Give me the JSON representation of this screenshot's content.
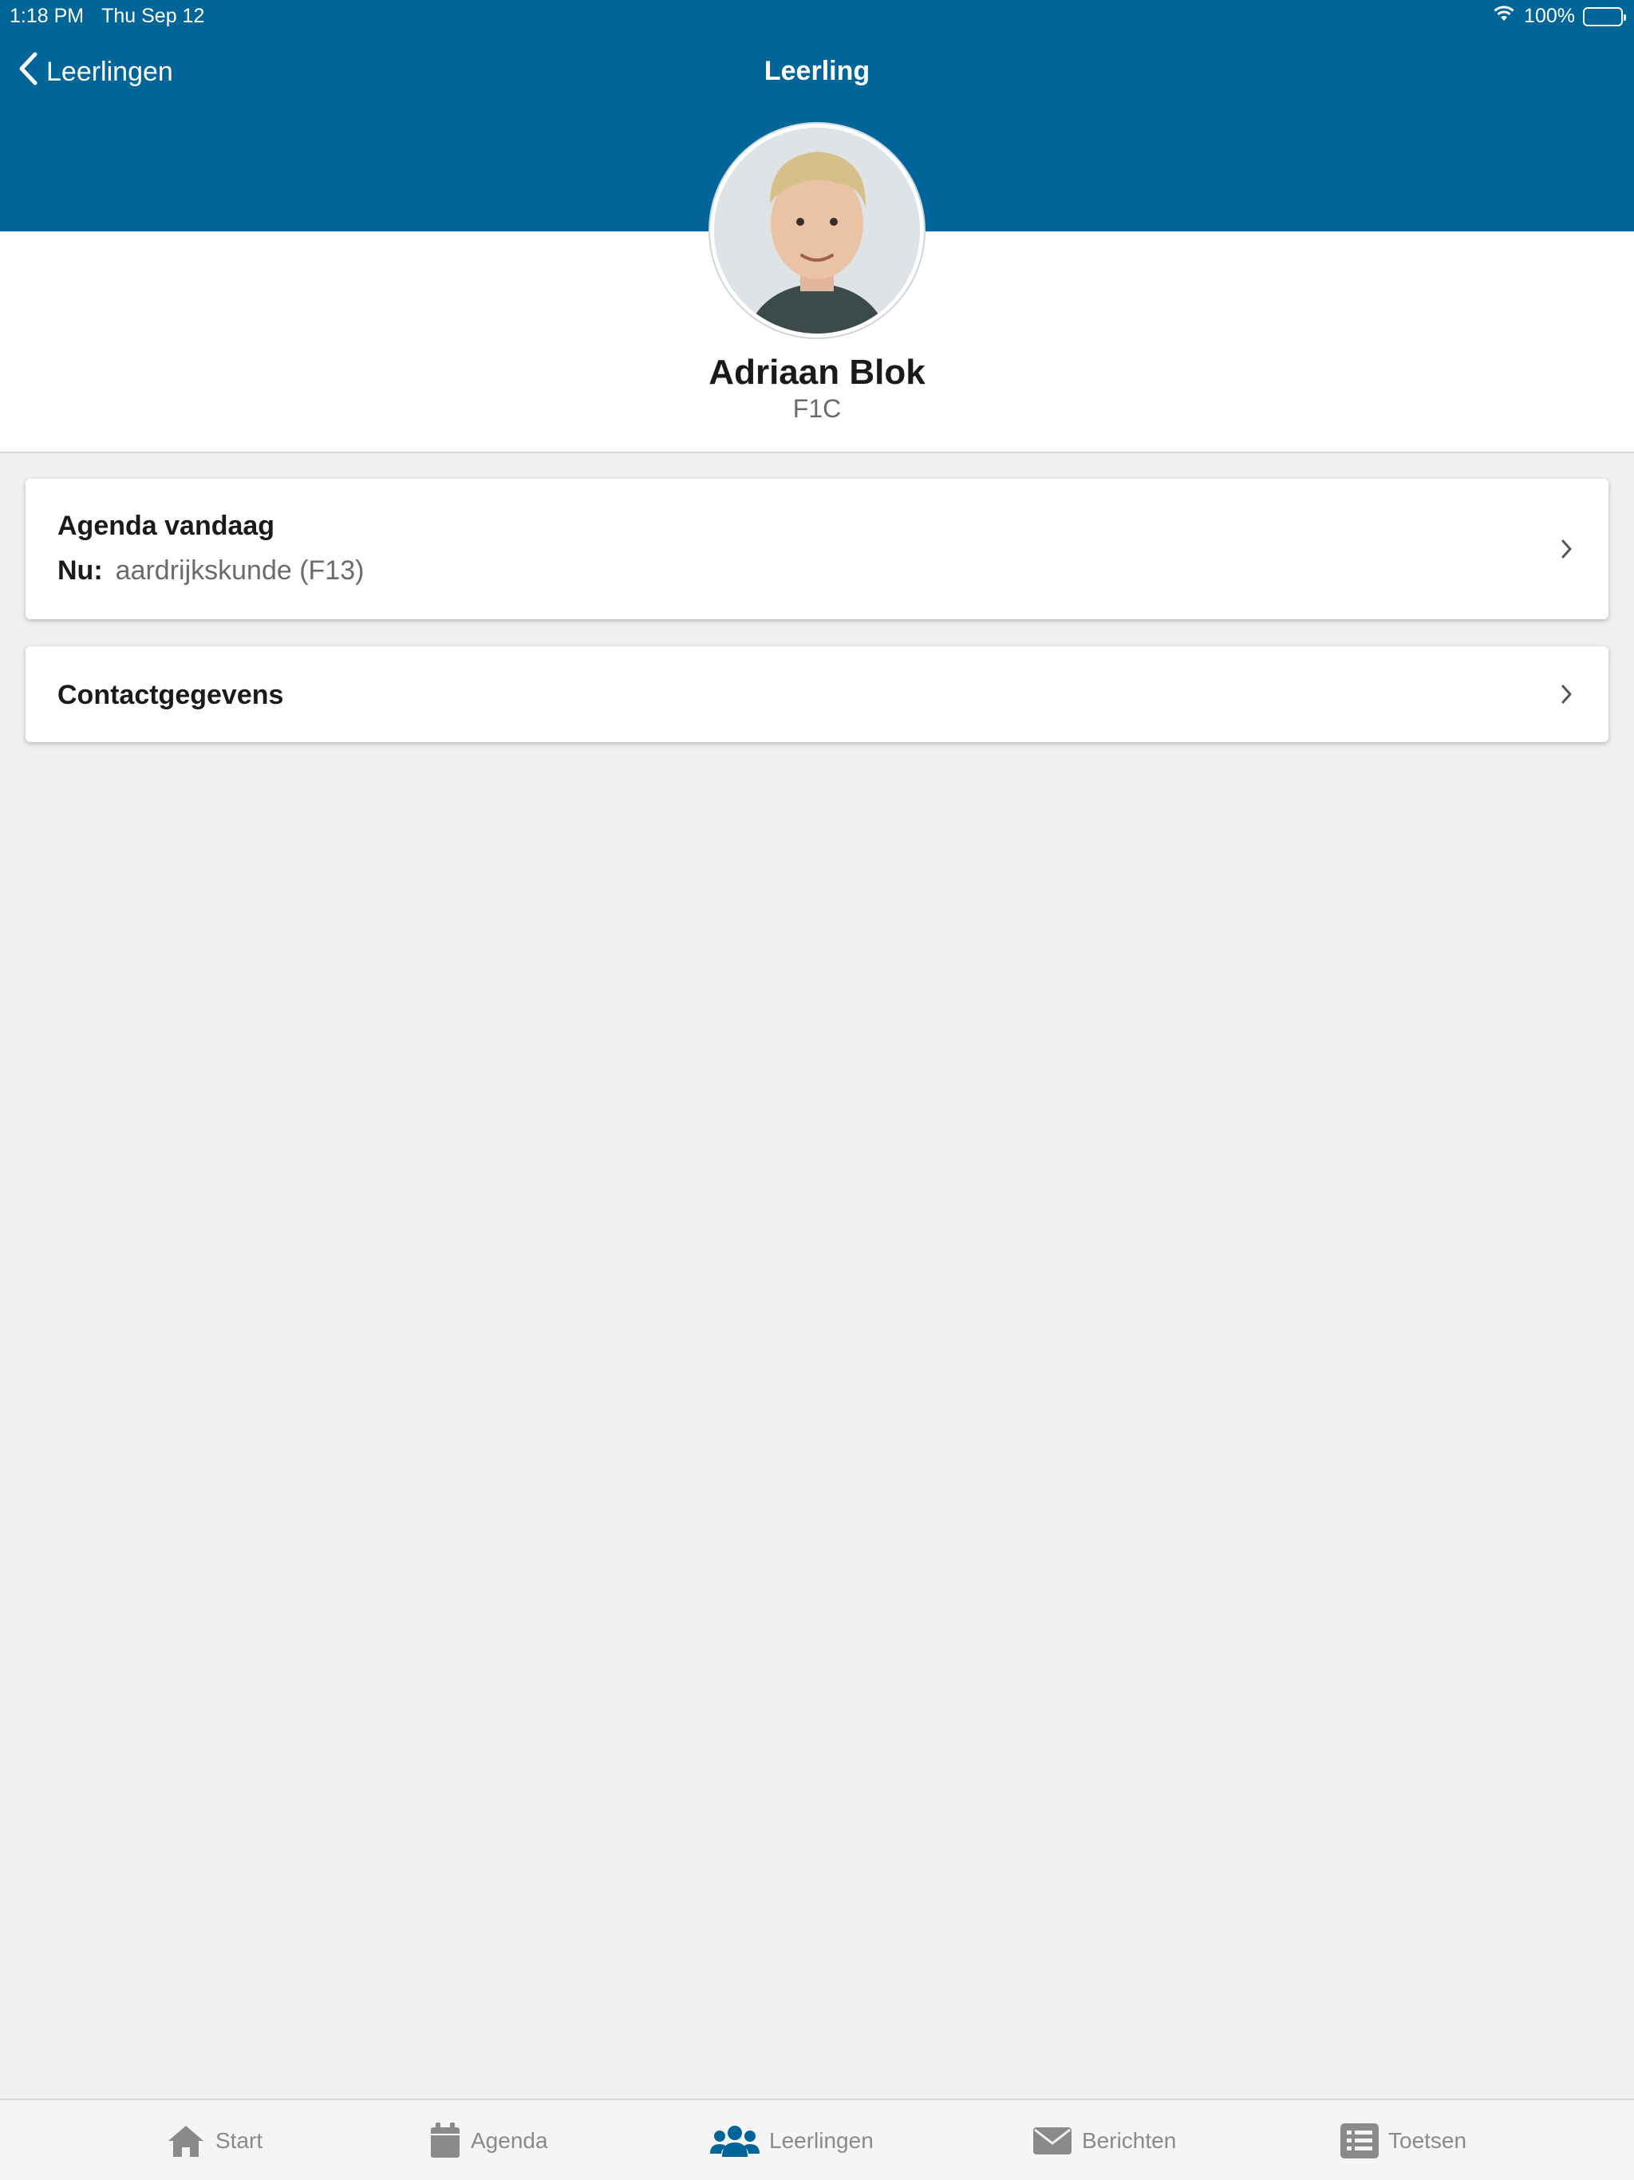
{
  "status_bar": {
    "time": "1:18 PM",
    "date": "Thu Sep 12",
    "battery": "100%"
  },
  "nav": {
    "back_label": "Leerlingen",
    "title": "Leerling"
  },
  "profile": {
    "name": "Adriaan Blok",
    "class": "F1C"
  },
  "cards": {
    "agenda": {
      "title": "Agenda vandaag",
      "now_label": "Nu:",
      "now_value": "aardrijkskunde (F13)"
    },
    "contact": {
      "title": "Contactgegevens"
    }
  },
  "tabbar": {
    "items": [
      {
        "label": "Start",
        "icon": "home-icon"
      },
      {
        "label": "Agenda",
        "icon": "calendar-icon"
      },
      {
        "label": "Leerlingen",
        "icon": "users-icon",
        "active": true
      },
      {
        "label": "Berichten",
        "icon": "envelope-icon"
      },
      {
        "label": "Toetsen",
        "icon": "list-icon"
      }
    ]
  },
  "colors": {
    "brand": "#006699",
    "active_tab_icon": "#006699",
    "inactive_tab": "#8a8a8a",
    "background": "#f0f0f0"
  }
}
